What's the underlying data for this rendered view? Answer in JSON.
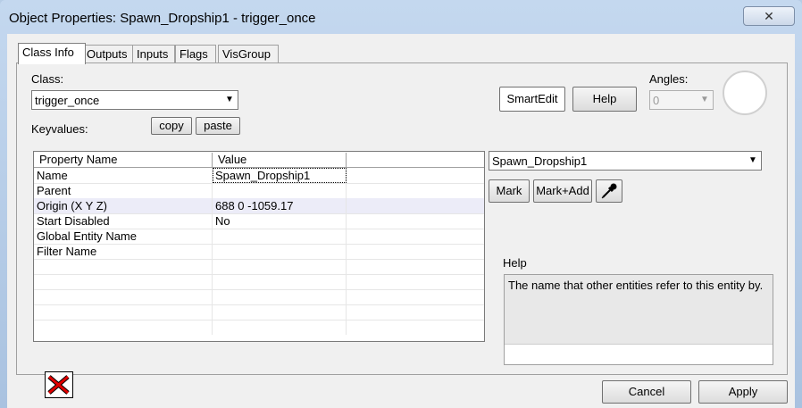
{
  "window": {
    "title": "Object Properties: Spawn_Dropship1 - trigger_once",
    "close": "✕"
  },
  "tabs": [
    {
      "label": "Class Info"
    },
    {
      "label": "Outputs"
    },
    {
      "label": "Inputs"
    },
    {
      "label": "Flags"
    },
    {
      "label": "VisGroup"
    }
  ],
  "class_section": {
    "label": "Class:",
    "value": "trigger_once",
    "keyvalues_label": "Keyvalues:",
    "copy": "copy",
    "paste": "paste"
  },
  "top_buttons": {
    "smartedit": "SmartEdit",
    "help": "Help"
  },
  "angles": {
    "label": "Angles:",
    "value": "0"
  },
  "grid": {
    "headers": [
      "Property Name",
      "Value"
    ],
    "rows": [
      {
        "name": "Name",
        "value": "Spawn_Dropship1"
      },
      {
        "name": "Parent",
        "value": ""
      },
      {
        "name": "Origin (X Y Z)",
        "value": "688 0 -1059.17"
      },
      {
        "name": "Start Disabled",
        "value": "No"
      },
      {
        "name": "Global Entity Name",
        "value": ""
      },
      {
        "name": "Filter Name",
        "value": ""
      }
    ]
  },
  "entity_combo": {
    "value": "Spawn_Dropship1"
  },
  "mark_buttons": {
    "mark": "Mark",
    "mark_add": "Mark+Add"
  },
  "help_panel": {
    "label": "Help",
    "text": "The name that other entities refer to this entity by."
  },
  "footer": {
    "cancel": "Cancel",
    "apply": "Apply"
  }
}
